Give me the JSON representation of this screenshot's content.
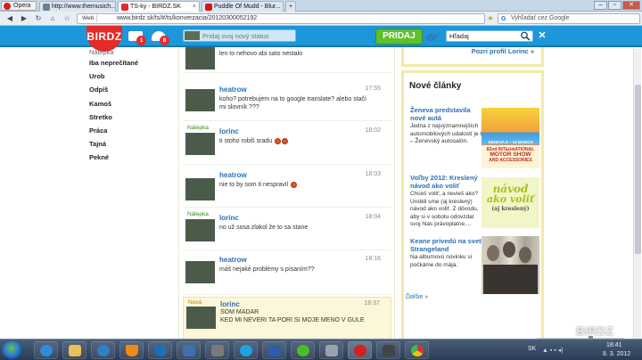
{
  "browser": {
    "menu_label": "Opera",
    "tabs": [
      {
        "label": "http://www.themusich..."
      },
      {
        "label": "TS-ky - BIRDZ.SK"
      },
      {
        "label": "Puddle Of Mudd - Blur..."
      }
    ],
    "address_prefix": "Web",
    "address": "www.birdz.sk/ts/#/ts/konverzacia/20120300052192",
    "search_placeholder": "Vyhľadať cez Google"
  },
  "header": {
    "logo": "BIRDZ",
    "messages_count": "1",
    "friends_count": "8",
    "status_placeholder": "Pridaj svoj nový status",
    "post_button": "PRIDAJ",
    "search_value": "Hľadaj",
    "close_glyph": "✕"
  },
  "leftnav": {
    "top_partial": "Nálepka",
    "items": [
      "Iba neprečítané",
      "Urob",
      "Odpíš",
      "Kamoš",
      "Stretko",
      "Práca",
      "Tajná",
      "Pekné"
    ]
  },
  "chat": {
    "messages": [
      {
        "tag": "",
        "user": "lorinc",
        "time": "",
        "text": "len to nehovo abi sato nestalo"
      },
      {
        "tag": "",
        "user": "heatrow",
        "time": "17:55",
        "text": "koho? potrebujem na to google translate? alebo stačí mi slovník ???"
      },
      {
        "tag": "Nálepka",
        "user": "lorinc",
        "time": "18:02",
        "text": "ti stoho robiš sradu"
      },
      {
        "tag": "",
        "user": "heatrow",
        "time": "18:03",
        "text": "nie to by som ti nespravil"
      },
      {
        "tag": "Nálepka",
        "user": "lorinc",
        "time": "18:04",
        "text": "no už sosa zlakol že to sa stane"
      },
      {
        "tag": "",
        "user": "heatrow",
        "time": "18:16",
        "text": "máš nejaké problémy s písaním??"
      },
      {
        "tag": "Nová",
        "user": "lorinc",
        "time": "18:37",
        "text": "SOM MADAR",
        "text2": "KED MI NEVERI TA PORI SI MOJE MENO V GULE"
      }
    ]
  },
  "right": {
    "profile_link": "Pozri profil Lorinc »",
    "articles_heading": "Nové články",
    "articles": [
      {
        "title": "Ženeva predstavila nové autá",
        "text": "Jedna z najvýznamnejších automobilových udalostí je tu – Ženevský autosalón."
      },
      {
        "title": "Voľby 2012: Kreslený návod ako voliť",
        "text": "Chceš voliť, a nevieš ako? Urobili sme (aj kreslený) návod ako voliť. Z dôvodu, aby si v sobotu odovzdal svoj hlas právoplatne...."
      },
      {
        "title": "Keane privedú na svet Strangeland",
        "text": "Na albumovú novinku si počkáme do mája."
      }
    ],
    "more_link": "Ďalšie »",
    "img1_text": [
      "82nd INTERNATIONAL",
      "MOTOR SHOW",
      "AND ACCESSORIES"
    ],
    "img1_dates": "GENEVA 8 – 18 MARCH 2012",
    "img2_text": [
      "návod",
      "ako voliť",
      "(aj kreslený)"
    ]
  },
  "taskbar": {
    "lang": "SK",
    "time": "18:41",
    "date": "8. 3. 2012"
  },
  "watermark": "BIRDZ",
  "colors": {
    "brand_blue": "#1d97d9",
    "brand_red": "#e52a2a",
    "link_blue": "#2a6fb5",
    "post_green": "#5fbf2d",
    "panel_border": "#f4e9a7"
  }
}
